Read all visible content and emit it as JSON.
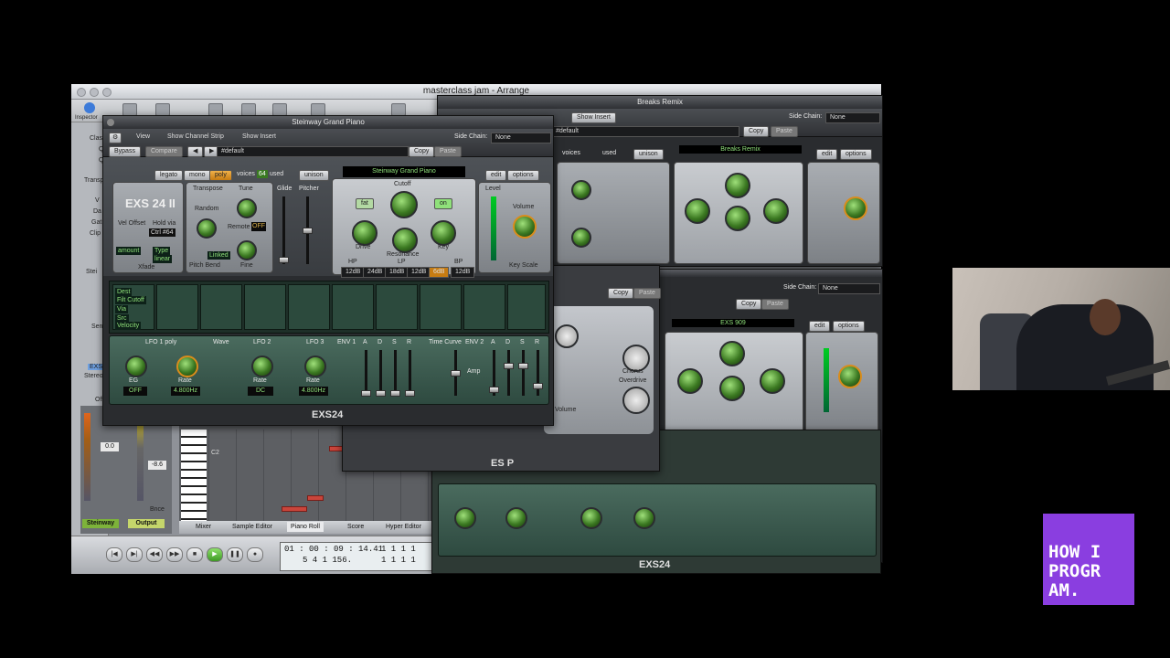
{
  "main_window": {
    "title": "masterclass jam - Arrange",
    "inspector_label": "Inspector",
    "inspector_items": [
      "Clas",
      "Q",
      "Q",
      "Transp",
      "V",
      "Da",
      "Gat",
      "Clip",
      "Stei",
      "Send",
      "EXS",
      "Stereo",
      "Off"
    ],
    "mixer": {
      "volume_left": "0.0",
      "volume_right": "-8.6",
      "bnce": "Bnce",
      "channel_left": "Steinway",
      "channel_right": "Output"
    },
    "bottom_tabs": [
      "Mixer",
      "Sample Editor",
      "Piano Roll",
      "Score",
      "Hyper Editor"
    ],
    "piano_roll_label": "C2",
    "transport": {
      "time": "01 : 00 : 09 : 14.41",
      "bars": "5   4   1  156.",
      "right_top": "1   1   1   1",
      "right_bottom": "1   1   1   1"
    }
  },
  "plugin_steinway": {
    "title": "Steinway Grand Piano",
    "view": "View",
    "show_channel_strip": "Show Channel Strip",
    "show_insert": "Show Insert",
    "side_chain_label": "Side Chain:",
    "side_chain_value": "None",
    "bypass": "Bypass",
    "compare": "Compare",
    "preset": "#default",
    "copy": "Copy",
    "paste": "Paste",
    "modes": [
      "legato",
      "mono",
      "poly"
    ],
    "voices_label": "voices",
    "voices_value": "64",
    "used_label": "used",
    "unison": "unison",
    "instrument_display": "Steinway Grand Piano",
    "edit": "edit",
    "options": "options",
    "logo": "EXS 24 II",
    "vel_offset": "Vel Offset",
    "hold_via": "Hold via",
    "hold_value": "Ctrl #64",
    "amount": "amount",
    "type": "Type",
    "linear": "linear",
    "xfade": "Xfade",
    "transpose": "Transpose",
    "tune": "Tune",
    "random": "Random",
    "remote": "Remote",
    "remote_value": "OFF",
    "linked": "Linked",
    "pitch_bend": "Pitch Bend",
    "fine": "Fine",
    "glide": "Glide",
    "pitcher": "Pitcher",
    "cutoff": "Cutoff",
    "fat": "fat",
    "on": "on",
    "drive": "Drive",
    "resonance": "Resonance",
    "key": "Key",
    "level": "Level",
    "volume": "Volume",
    "key_scale": "Key Scale",
    "filter_modes": [
      "12dB",
      "24dB",
      "18dB",
      "12dB",
      "6dB",
      "12dB"
    ],
    "filter_groups": [
      "HP",
      "LP",
      "BP"
    ],
    "mod_labels": [
      "Dest",
      "Via",
      "Src"
    ],
    "mod_first": [
      "Filt Cutoff",
      "Velocity"
    ],
    "lfo1": "LFO 1 poly",
    "wave": "Wave",
    "lfo2": "LFO 2",
    "lfo3": "LFO 3",
    "env1": "ENV 1",
    "env2": "ENV 2",
    "time_curve": "Time Curve",
    "amp": "Amp",
    "adsr": [
      "A",
      "D",
      "S",
      "R"
    ],
    "lfo_values": [
      "OFF",
      "4.800Hz",
      "DC",
      "4.800Hz"
    ],
    "eg": "EG",
    "rate": "Rate",
    "footer": "EXS24"
  },
  "plugin_breaks": {
    "title": "Breaks Remix",
    "show_insert": "Show Insert",
    "side_chain_label": "Side Chain:",
    "side_chain_value": "None",
    "preset": "#default",
    "copy": "Copy",
    "paste": "Paste",
    "instrument_display": "Breaks Remix",
    "voices_label": "voices",
    "used_label": "used",
    "unison": "unison",
    "edit": "edit",
    "options": "options"
  },
  "plugin_esp": {
    "copy": "Copy",
    "paste": "Paste",
    "chorus": "Chorus",
    "overdrive": "Overdrive",
    "volume": "Volume",
    "footer": "ES P"
  },
  "plugin_exs909": {
    "side_chain_label": "Side Chain:",
    "side_chain_value": "None",
    "copy": "Copy",
    "paste": "Paste",
    "instrument_display": "EXS 909",
    "edit": "edit",
    "options": "options",
    "footer": "EXS24"
  },
  "badge_lines": [
    "HOW I",
    "PROGR",
    "AM."
  ],
  "colors": {
    "badge": "#8a3ee0",
    "led_green": "#8fe07a",
    "display_amber": "#d9b04a"
  }
}
